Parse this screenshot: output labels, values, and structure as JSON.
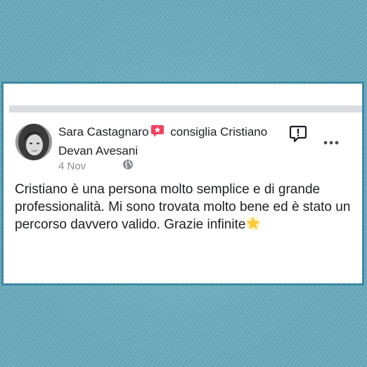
{
  "post": {
    "author": "Sara Castagnaro",
    "action": "consiglia Cristiano Devan Avesani",
    "date": "4 Nov",
    "text": "Cristiano è una persona molto semplice e di grande professionalità. Mi sono trovata molto bene ed è stato un percorso davvero valido. Grazie infinite"
  },
  "icons": {
    "recommend": "recommend-badge-icon",
    "globe": "globe-icon",
    "report": "report-flag-icon",
    "more": "more-options-icon",
    "star": "glowing-star-icon"
  },
  "colors": {
    "background": "#69abbd",
    "card_border": "#3d8aa3",
    "recommend_red": "#f3425f",
    "text": "#1c1e21",
    "meta_text": "#8a8d91"
  }
}
